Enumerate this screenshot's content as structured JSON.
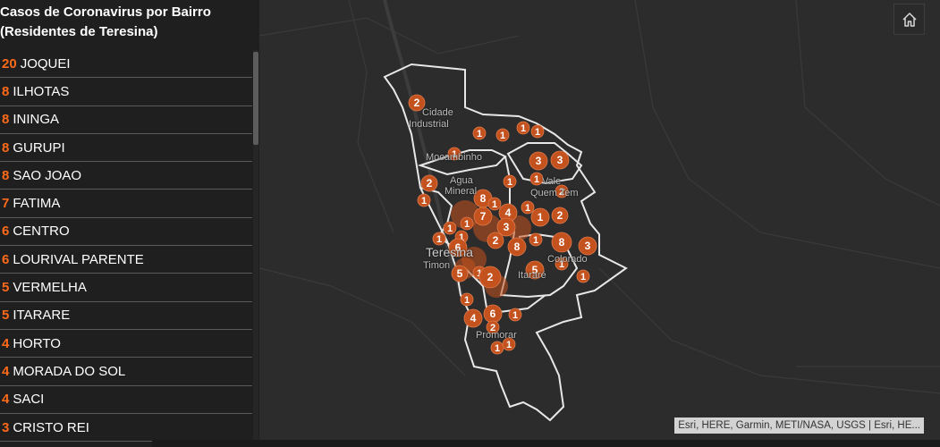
{
  "sidebar": {
    "title_line1": "Casos de Coronavirus por Bairro",
    "title_line2": "(Residentes de Teresina)",
    "items": [
      {
        "count": "20",
        "name": "JOQUEI"
      },
      {
        "count": "8",
        "name": "ILHOTAS"
      },
      {
        "count": "8",
        "name": "ININGA"
      },
      {
        "count": "8",
        "name": "GURUPI"
      },
      {
        "count": "8",
        "name": "SAO JOAO"
      },
      {
        "count": "7",
        "name": "FATIMA"
      },
      {
        "count": "6",
        "name": "CENTRO"
      },
      {
        "count": "6",
        "name": "LOURIVAL PARENTE"
      },
      {
        "count": "5",
        "name": "VERMELHA"
      },
      {
        "count": "5",
        "name": "ITARARE"
      },
      {
        "count": "4",
        "name": "HORTO"
      },
      {
        "count": "4",
        "name": "MORADA DO SOL"
      },
      {
        "count": "4",
        "name": "SACI"
      },
      {
        "count": "3",
        "name": "CRISTO REI"
      }
    ]
  },
  "map": {
    "labels": {
      "cidade": "Cidade",
      "industrial": "Industrial",
      "mocambinho": "Mocambinho",
      "agua": "Agua",
      "mineral": "Mineral",
      "vale": "Vale",
      "quem_tem": "Quem Tem",
      "teresina": "Teresina",
      "timon": "Timon",
      "colorado": "Colorado",
      "itarare": "Itararé",
      "promorar": "Promorar"
    },
    "markers": [
      "2",
      "1",
      "1",
      "1",
      "1",
      "1",
      "3",
      "3",
      "2",
      "1",
      "1",
      "1",
      "2",
      "8",
      "1",
      "1",
      "7",
      "4",
      "1",
      "1",
      "2",
      "1",
      "1",
      "1",
      "3",
      "2",
      "8",
      "1",
      "8",
      "3",
      "6",
      "5",
      "1",
      "2",
      "5",
      "1",
      "1",
      "1",
      "4",
      "6",
      "1",
      "2",
      "1",
      "1"
    ],
    "attribution": "Esri, HERE, Garmin, METI/NASA, USGS | Esri, HE...",
    "home_icon": "home-icon",
    "accent": "#c4521e"
  }
}
